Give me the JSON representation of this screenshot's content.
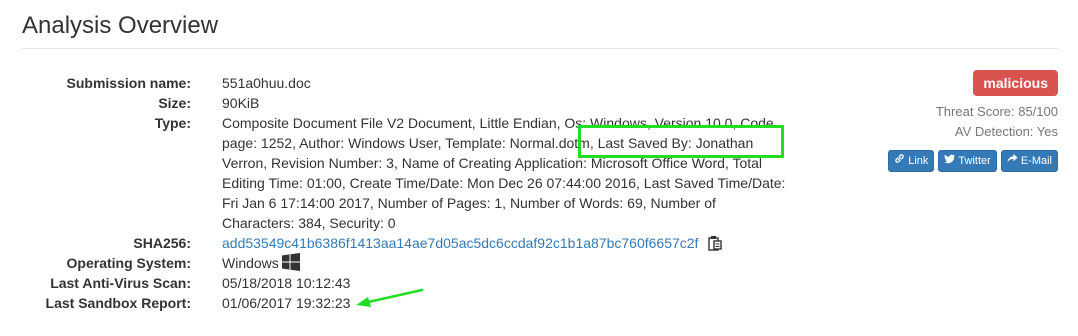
{
  "header": {
    "title": "Analysis Overview"
  },
  "details": {
    "submission_name": {
      "label": "Submission name:",
      "value": "551a0huu.doc"
    },
    "size": {
      "label": "Size:",
      "value": "90KiB"
    },
    "type": {
      "label": "Type:",
      "value": "Composite Document File V2 Document, Little Endian, Os: Windows, Version 10.0, Code page: 1252, Author: Windows User, Template: Normal.dotm, Last Saved By: Jonathan Verron, Revision Number: 3, Name of Creating Application: Microsoft Office Word, Total Editing Time: 01:00, Create Time/Date: Mon Dec 26 07:44:00 2016, Last Saved Time/Date: Fri Jan 6 17:14:00 2017, Number of Pages: 1, Number of Words: 69, Number of Characters: 384, Security: 0"
    },
    "sha256": {
      "label": "SHA256:",
      "value": "add53549c41b6386f1413aa14ae7d05ac5dc6ccdaf92c1b1a87bc760f6657c2f"
    },
    "os": {
      "label": "Operating System:",
      "value": "Windows"
    },
    "av_scan": {
      "label": "Last Anti-Virus Scan:",
      "value": "05/18/2018 10:12:43"
    },
    "sandbox": {
      "label": "Last Sandbox Report:",
      "value": "01/06/2017 19:32:23"
    }
  },
  "sidebar": {
    "verdict": "malicious",
    "threat_score": "Threat Score: 85/100",
    "av_detection": "AV Detection: Yes",
    "share": {
      "link": "Link",
      "twitter": "Twitter",
      "email": "E-Mail"
    }
  },
  "colors": {
    "accent": "#337ab7",
    "malicious": "#d9534f",
    "annotation": "#22dd22"
  },
  "icons": {
    "copy": "clipboard-icon",
    "os": "windows-icon",
    "link": "link-icon",
    "twitter": "twitter-icon",
    "email": "share-icon"
  }
}
